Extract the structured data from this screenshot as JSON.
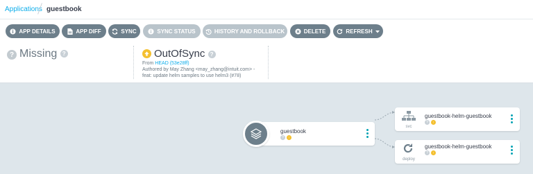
{
  "breadcrumb": {
    "parent": "Applications",
    "current": "guestbook"
  },
  "toolbar": {
    "app_details": "APP DETAILS",
    "app_diff": "APP DIFF",
    "sync": "SYNC",
    "sync_status": "SYNC STATUS",
    "history_rollback": "HISTORY AND ROLLBACK",
    "delete": "DELETE",
    "refresh": "REFRESH"
  },
  "status": {
    "health": "Missing",
    "sync": "OutOfSync",
    "from_prefix": "From",
    "revision": "HEAD (53e28ff)",
    "author_line": "Authored by May Zhang <may_zhang@intuit.com> -",
    "commit_line": "feat: update helm samples to use helm3 (#78)"
  },
  "tree": {
    "root": {
      "name": "guestbook"
    },
    "children": [
      {
        "name": "guestbook-helm-guestbook",
        "kind": "svc"
      },
      {
        "name": "guestbook-helm-guestbook",
        "kind": "deploy"
      }
    ]
  },
  "colors": {
    "accent": "#0dadea",
    "button": "#6d7f8b",
    "button_disabled": "#b9c4cb",
    "out_of_sync": "#f4c030",
    "kebab": "#00a2b3"
  }
}
